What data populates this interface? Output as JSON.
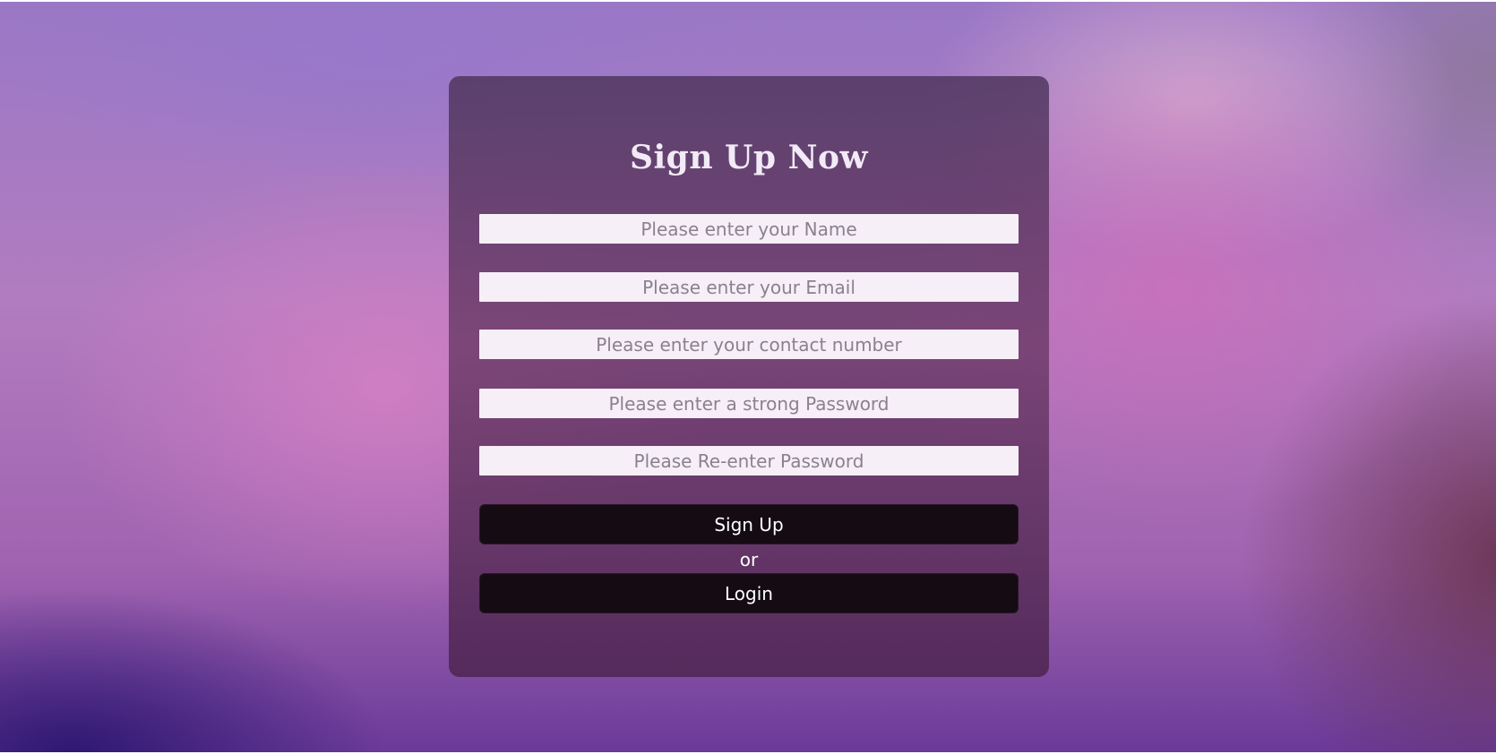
{
  "form": {
    "title": "Sign Up Now",
    "fields": [
      {
        "placeholder": "Please enter your Name",
        "value": ""
      },
      {
        "placeholder": "Please enter your Email",
        "value": ""
      },
      {
        "placeholder": "Please enter your contact number",
        "value": ""
      },
      {
        "placeholder": "Please enter a strong Password",
        "value": ""
      },
      {
        "placeholder": "Please Re-enter Password",
        "value": ""
      }
    ],
    "signup_label": "Sign Up",
    "or_label": "or",
    "login_label": "Login"
  },
  "colors": {
    "card_background": "#5e3a66",
    "field_background": "#f6eff7",
    "button_background": "#140b13",
    "text_light": "#ffffff"
  }
}
